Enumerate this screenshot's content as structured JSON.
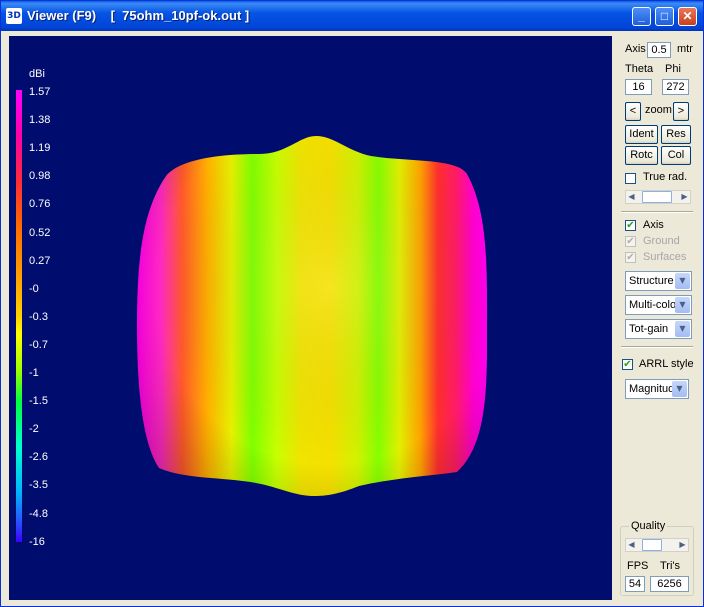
{
  "window": {
    "icon_text": "3D",
    "title": "Viewer (F9)    [  75ohm_10pf-ok.out ]",
    "buttons": {
      "minimize": "_",
      "maximize": "□",
      "close": "✕"
    }
  },
  "legend": {
    "unit": "dBi",
    "ticks": [
      "1.57",
      "1.38",
      "1.19",
      "0.98",
      "0.76",
      "0.52",
      "0.27",
      "-0",
      "-0.3",
      "-0.7",
      "-1",
      "-1.5",
      "-2",
      "-2.6",
      "-3.5",
      "-4.8",
      "-16"
    ]
  },
  "panel": {
    "axis_label": "Axis",
    "axis_value": "0.5",
    "axis_unit": "mtr",
    "theta_label": "Theta",
    "phi_label": "Phi",
    "theta_value": "16",
    "phi_value": "272",
    "zoom_left": "<",
    "zoom_label": "zoom",
    "zoom_right": ">",
    "ident": "Ident",
    "res": "Res",
    "rotc": "Rotc",
    "col": "Col",
    "true_rad": "True rad.",
    "true_rad_checked": false,
    "axis_check": "Axis",
    "axis_checked": true,
    "ground": "Ground",
    "ground_checked": true,
    "surfaces": "Surfaces",
    "surfaces_checked": true,
    "select_structure": "Structure",
    "select_color": "Multi-color",
    "select_gain": "Tot-gain",
    "arrl": "ARRL style",
    "arrl_checked": true,
    "select_magnitude": "Magnitude",
    "quality_label": "Quality",
    "fps_label": "FPS",
    "tris_label": "Tri's",
    "fps_value": "54",
    "tris_value": "6256"
  }
}
